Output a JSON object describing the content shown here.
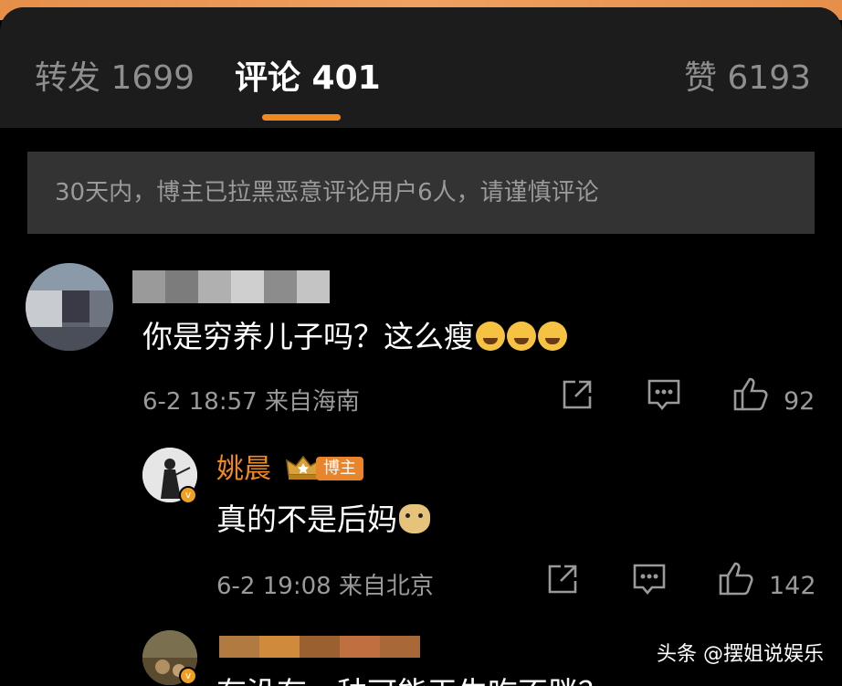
{
  "tabs": {
    "repost": "转发 1699",
    "comments": "评论 401",
    "likes": "赞 6193"
  },
  "notice": "30天内，博主已拉黑恶意评论用户6人，请谨慎评论",
  "comments": [
    {
      "username": "",
      "text": "你是穷养儿子吗？这么瘦",
      "emoji": "laughing-crying-emoji",
      "meta": "6-2 18:57 来自海南",
      "likes": "92"
    },
    {
      "username": "姚晨",
      "badge": "博主",
      "text": "真的不是后妈",
      "emoji": "doge-emoji",
      "meta": "6-2 19:08 来自北京",
      "likes": "142"
    },
    {
      "username": "",
      "text": "有没有一种可能天生吃不胖？"
    }
  ],
  "watermark": "头条 @摆姐说娱乐",
  "colors": {
    "accent": "#f08a1e",
    "background": "#000000",
    "tabbar": "#1c1c1c",
    "notice_bg": "#333333",
    "secondary_text": "#9a9a9a"
  }
}
